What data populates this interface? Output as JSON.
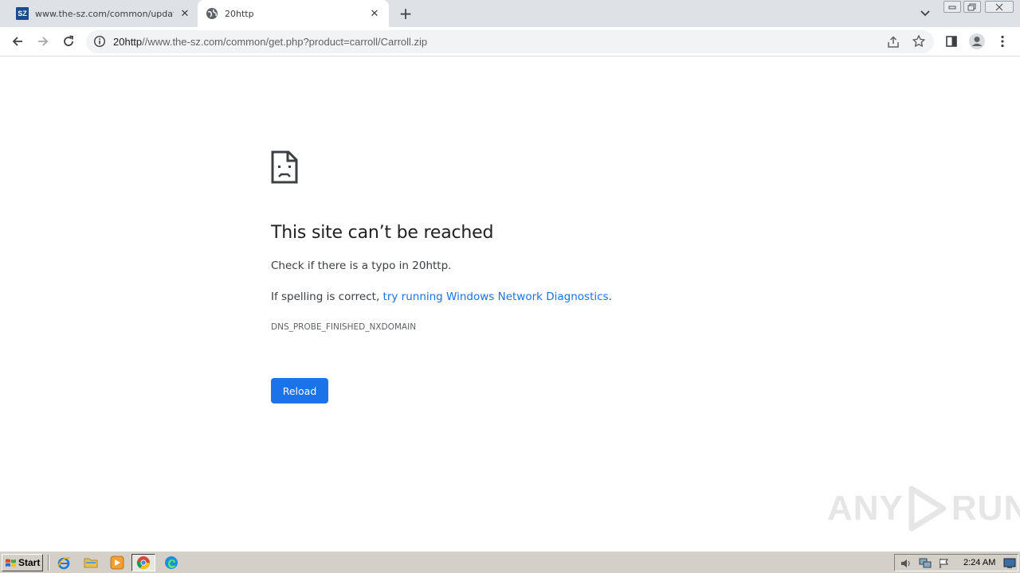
{
  "browser": {
    "tabs": [
      {
        "title": "www.the-sz.com/common/update.ph",
        "favicon": "sz-logo-icon",
        "active": false
      },
      {
        "title": "20http",
        "favicon": "globe-icon",
        "active": true
      }
    ],
    "new_tab_symbol": "+",
    "favicon_text": "SZ",
    "address": {
      "host": "20http",
      "path": "//www.the-sz.com/common/get.php?product=carroll/Carroll.zip"
    }
  },
  "error_page": {
    "title": "This site can’t be reached",
    "line1": "Check if there is a typo in 20http.",
    "line2_prefix": "If spelling is correct, ",
    "line2_link": "try running Windows Network Diagnostics",
    "line2_suffix": ".",
    "error_code": "DNS_PROBE_FINISHED_NXDOMAIN",
    "reload_label": "Reload",
    "accent_color": "#1a73e8"
  },
  "watermark": {
    "left": "ANY",
    "right": "RUN"
  },
  "taskbar": {
    "start_label": "Start",
    "clock": "2:24 AM",
    "quick_launch": [
      "internet-explorer-icon",
      "folder-icon",
      "media-player-icon",
      "chrome-icon",
      "edge-icon"
    ],
    "tray": [
      "speaker-icon",
      "network-icon",
      "flag-icon",
      "monitor-icon"
    ]
  }
}
